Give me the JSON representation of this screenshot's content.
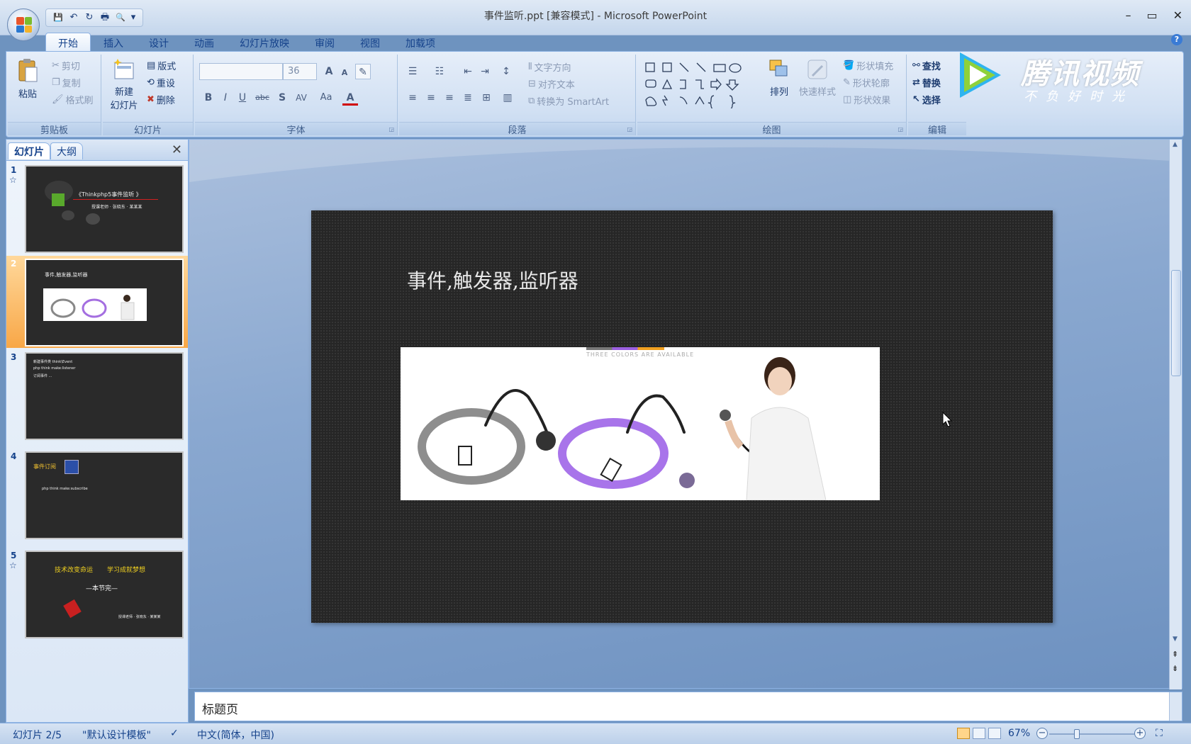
{
  "window": {
    "title": "事件监听.ppt [兼容模式] - Microsoft PowerPoint",
    "minimize": "–",
    "maximize": "▭",
    "close": "✕"
  },
  "qat": {
    "save": "💾",
    "undo": "↶",
    "redo": "↻",
    "print": "🖶",
    "preview": "🔍",
    "more": "▾"
  },
  "tabs": [
    "开始",
    "插入",
    "设计",
    "动画",
    "幻灯片放映",
    "审阅",
    "视图",
    "加载项"
  ],
  "ribbon": {
    "clipboard": {
      "label": "剪贴板",
      "paste": "粘贴",
      "cut": "剪切",
      "copy": "复制",
      "format_painter": "格式刷"
    },
    "slides": {
      "label": "幻灯片",
      "new_slide": "新建",
      "new_slide2": "幻灯片",
      "layout": "版式",
      "reset": "重设",
      "delete": "删除"
    },
    "font": {
      "label": "字体",
      "font_name": "",
      "font_size": "36",
      "grow": "A",
      "shrink": "A",
      "bold": "B",
      "italic": "I",
      "underline": "U",
      "strike": "abc",
      "shadow": "S",
      "spacing": "AV",
      "case": "Aa",
      "color": "A"
    },
    "paragraph": {
      "label": "段落",
      "text_direction": "文字方向",
      "align_text": "对齐文本",
      "smartart": "转换为 SmartArt"
    },
    "drawing": {
      "label": "绘图",
      "arrange": "排列",
      "quick_styles": "快速样式",
      "shape_fill": "形状填充",
      "shape_outline": "形状轮廓",
      "shape_effects": "形状效果"
    },
    "editing": {
      "label": "编辑",
      "find": "查找",
      "replace": "替换",
      "select": "选择"
    }
  },
  "watermark": {
    "brand": "腾讯视频",
    "slogan": "不负好时光"
  },
  "left_pane": {
    "tab_slides": "幻灯片",
    "tab_outline": "大纲",
    "close": "✕",
    "thumbnails": [
      {
        "num": "1",
        "star": "☆",
        "lines": [
          "《Thinkphp5事件监听 》",
          "授课老师 · 张晓东 · 某某某"
        ]
      },
      {
        "num": "2",
        "star": "",
        "lines": [
          "事件,触发器,监听器"
        ]
      },
      {
        "num": "3",
        "star": "",
        "lines": [
          "新建事件类 think\\Event",
          "php think make:listener",
          "订阅事件 ..."
        ]
      },
      {
        "num": "4",
        "star": "",
        "lines": [
          "事件订阅",
          "php think make:subscribe"
        ]
      },
      {
        "num": "5",
        "star": "☆",
        "lines": [
          "技术改变命运",
          "学习成就梦想",
          "—本节完—",
          "授课老师 · 张晓东 · 某某某"
        ]
      }
    ]
  },
  "slide": {
    "title": "事件,触发器,监听器",
    "image_caption": "THREE COLORS ARE AVAILABLE"
  },
  "notes": {
    "text": "标题页"
  },
  "status": {
    "slide_counter": "幻灯片 2/5",
    "theme": "\"默认设计模板\"",
    "language": "中文(简体，中国)",
    "zoom": "67%",
    "zoom_minus": "−",
    "zoom_plus": "+"
  },
  "colors": {
    "ribbon": "#d1e0f3",
    "selected_thumb": "#f8a747",
    "slide_bg": "#262626"
  }
}
